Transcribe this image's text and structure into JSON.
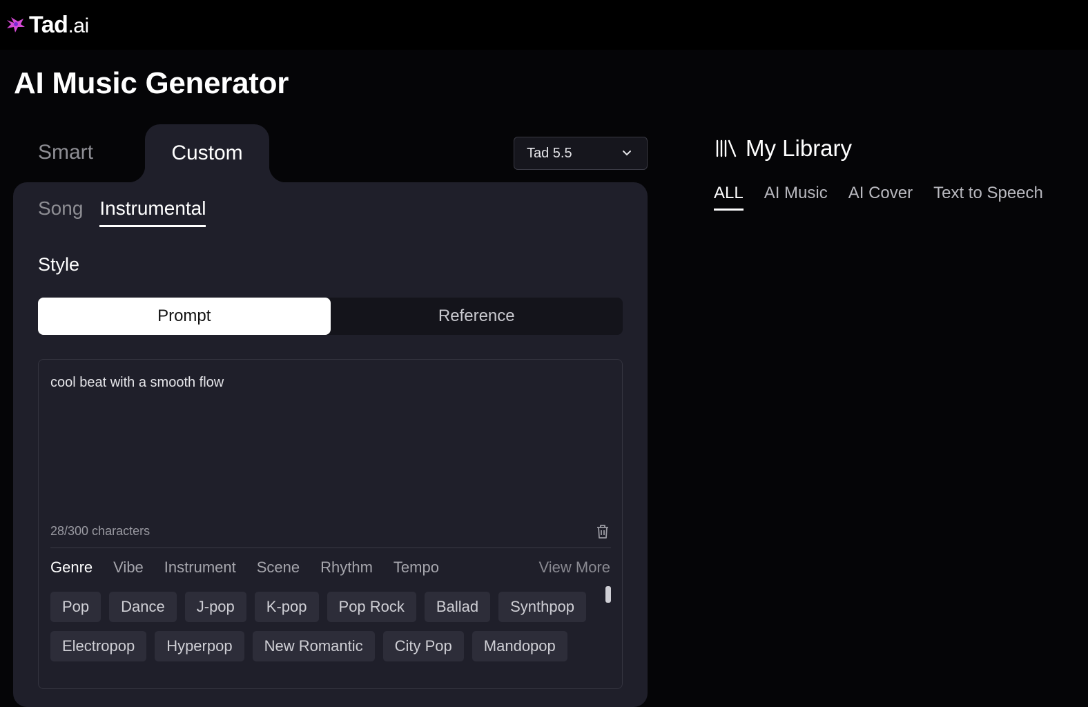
{
  "brand": {
    "name": "Tad",
    "suffix": ".ai",
    "accent": "#d64bd6"
  },
  "page": {
    "title": "AI Music Generator"
  },
  "mode_tabs": [
    {
      "label": "Smart",
      "active": false
    },
    {
      "label": "Custom",
      "active": true
    }
  ],
  "model_select": {
    "value": "Tad 5.5"
  },
  "sub_tabs": [
    {
      "label": "Song",
      "active": false
    },
    {
      "label": "Instrumental",
      "active": true
    }
  ],
  "style": {
    "label": "Style",
    "segments": [
      {
        "label": "Prompt",
        "active": true
      },
      {
        "label": "Reference",
        "active": false
      }
    ]
  },
  "prompt": {
    "value": "cool beat with a smooth flow",
    "char_count": "28/300 characters"
  },
  "category_tabs": [
    {
      "label": "Genre",
      "active": true
    },
    {
      "label": "Vibe",
      "active": false
    },
    {
      "label": "Instrument",
      "active": false
    },
    {
      "label": "Scene",
      "active": false
    },
    {
      "label": "Rhythm",
      "active": false
    },
    {
      "label": "Tempo",
      "active": false
    }
  ],
  "view_more": "View More",
  "genre_chips": [
    "Pop",
    "Dance",
    "J-pop",
    "K-pop",
    "Pop Rock",
    "Ballad",
    "Synthpop",
    "Electropop",
    "Hyperpop",
    "New Romantic",
    "City Pop",
    "Mandopop"
  ],
  "library": {
    "title": "My Library",
    "tabs": [
      {
        "label": "ALL",
        "active": true
      },
      {
        "label": "AI Music",
        "active": false
      },
      {
        "label": "AI Cover",
        "active": false
      },
      {
        "label": "Text to Speech",
        "active": false
      }
    ]
  }
}
